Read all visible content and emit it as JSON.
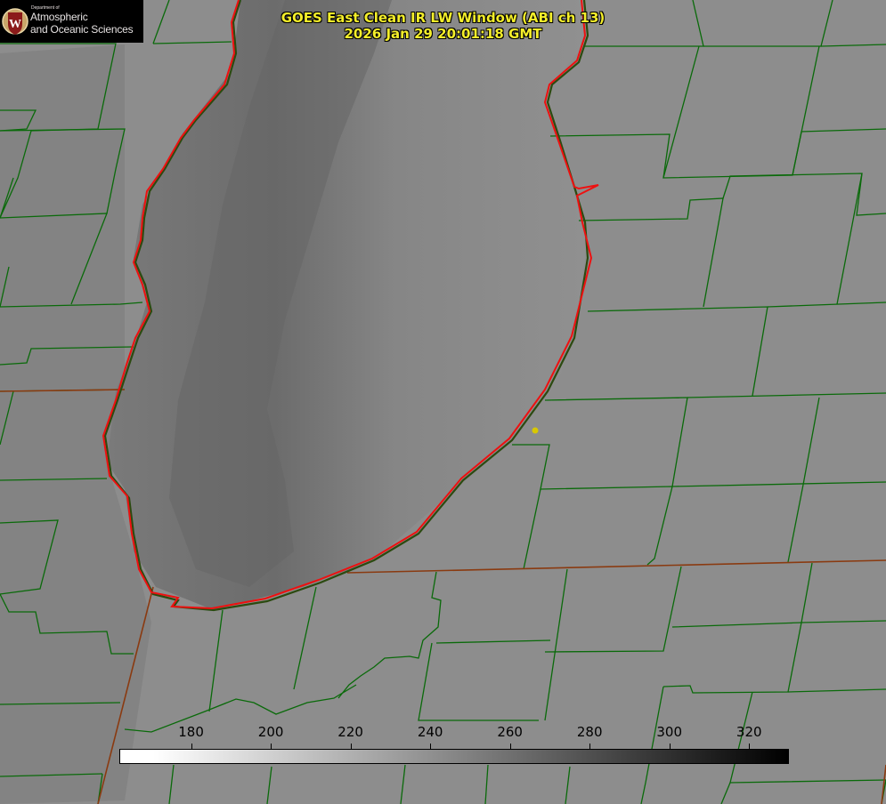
{
  "title": {
    "line1": "GOES East Clean IR LW Window (ABI ch 13)",
    "line2": "2026 Jan 29 20:01:18 GMT"
  },
  "logo": {
    "dept_text": "Department of",
    "line1": "Atmospheric",
    "line2": "and Oceanic Sciences",
    "seal_letter": "W",
    "seal_color": "#8b1a1a"
  },
  "colorbar": {
    "ticks": [
      "180",
      "200",
      "220",
      "240",
      "260",
      "280",
      "300",
      "320"
    ],
    "tick_values": [
      180,
      200,
      220,
      240,
      260,
      280,
      300,
      320
    ],
    "min": 162,
    "max": 330,
    "units": ""
  },
  "colors": {
    "background_gray": "#8c8c8c",
    "lake_gray": "#909090",
    "cloud_gray": "#6f6f6f",
    "county_lines": "#0a6a0a",
    "shoreline": "#ee1010",
    "state_line": "#8a3a10",
    "title_yellow": "#f4ee2a",
    "marker_yellow": "#d8c800"
  },
  "icons": {
    "location_marker": "yellow-dot-icon",
    "logo_seal": "uw-crest-icon"
  }
}
